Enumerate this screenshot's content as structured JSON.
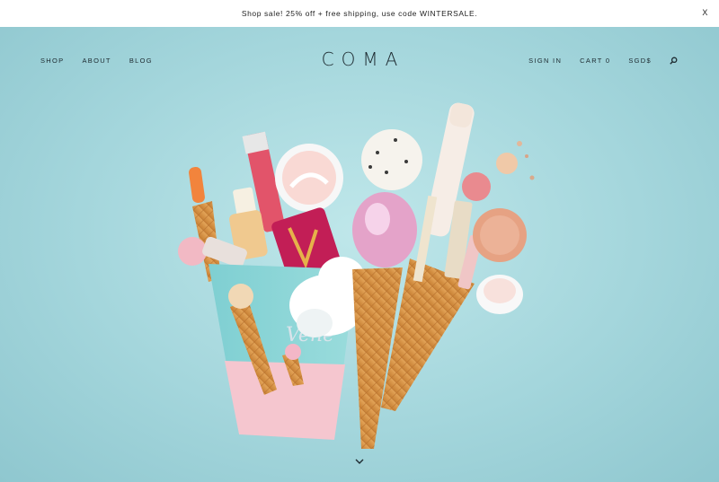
{
  "promo": {
    "text": "Shop sale! 25% off + free shipping, use code WINTERSALE.",
    "close_label": "X"
  },
  "nav": {
    "left": [
      {
        "label": "SHOP"
      },
      {
        "label": "ABOUT"
      },
      {
        "label": "BLOG"
      }
    ],
    "right": {
      "sign_in": "SIGN IN",
      "cart": "CART 0",
      "currency": "SGD$"
    }
  },
  "brand": {
    "logo_text": "COMA"
  },
  "hero": {
    "cup_script_text": "Vene",
    "background_color": "#a9d8dd"
  },
  "icons": {
    "search": "search-icon",
    "scroll": "chevron-down-icon"
  }
}
